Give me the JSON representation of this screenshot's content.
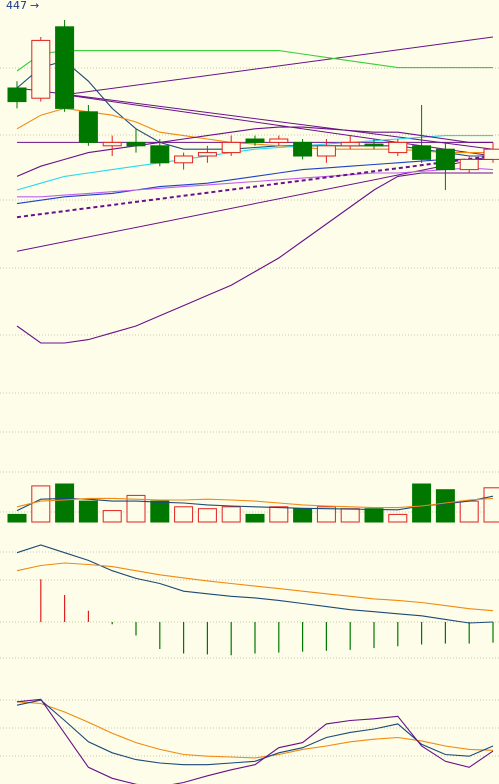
{
  "colors": {
    "background": "#fdfde9",
    "grid": "#9a9a78",
    "up": "#e02020",
    "down": "#007800",
    "ma_short": "#1c4a78",
    "ma_mid": "#f08a10",
    "ma_long": "#3ad03a",
    "cyan": "#28d8f0",
    "blue": "#2040c8",
    "purple": "#6a108a",
    "pink": "#c060f0"
  },
  "chart_data": [
    {
      "type": "candlestick",
      "title": "",
      "annotation": "447",
      "pointer_icon": "right-arrow-icon",
      "ylim": [
        0,
        100
      ],
      "grid": true,
      "candles": [
        {
          "open": 80,
          "close": 76,
          "high": 82,
          "low": 74
        },
        {
          "open": 77,
          "close": 94,
          "high": 95,
          "low": 76
        },
        {
          "open": 98,
          "close": 74,
          "high": 100,
          "low": 73
        },
        {
          "open": 73,
          "close": 64,
          "high": 75,
          "low": 63
        },
        {
          "open": 63,
          "close": 64,
          "high": 66,
          "low": 60
        },
        {
          "open": 64,
          "close": 63,
          "high": 68,
          "low": 61
        },
        {
          "open": 63,
          "close": 58,
          "high": 65,
          "low": 57
        },
        {
          "open": 58,
          "close": 60,
          "high": 61,
          "low": 56
        },
        {
          "open": 60,
          "close": 61,
          "high": 63,
          "low": 58
        },
        {
          "open": 61,
          "close": 64,
          "high": 66,
          "low": 60
        },
        {
          "open": 65,
          "close": 64,
          "high": 66,
          "low": 63
        },
        {
          "open": 64,
          "close": 65,
          "high": 66,
          "low": 63
        },
        {
          "open": 64,
          "close": 60,
          "high": 65,
          "low": 59
        },
        {
          "open": 60,
          "close": 63,
          "high": 65,
          "low": 58
        },
        {
          "open": 63,
          "close": 64,
          "high": 66,
          "low": 62
        },
        {
          "open": 63.5,
          "close": 63,
          "high": 65,
          "low": 62
        },
        {
          "open": 61,
          "close": 64,
          "high": 65,
          "low": 60
        },
        {
          "open": 63,
          "close": 59,
          "high": 75,
          "low": 58
        },
        {
          "open": 62,
          "close": 56,
          "high": 64,
          "low": 50
        },
        {
          "open": 56,
          "close": 59,
          "high": 60,
          "low": 55
        },
        {
          "open": 59,
          "close": 62,
          "high": 64,
          "low": 58
        }
      ],
      "lines": [
        {
          "color": "ma_short",
          "values": [
            80,
            86,
            88,
            82,
            74,
            68,
            64,
            62,
            62,
            62,
            62.5,
            63,
            63,
            63,
            63,
            63,
            63,
            62,
            61,
            60,
            60
          ]
        },
        {
          "color": "ma_mid",
          "values": [
            68,
            72,
            74,
            73,
            72,
            70,
            67,
            66,
            65,
            64,
            63.5,
            63,
            62.5,
            62,
            62,
            62,
            62,
            61.5,
            61,
            61,
            61
          ]
        },
        {
          "color": "ma_long",
          "values": [
            85,
            90,
            91,
            91,
            91,
            91,
            91,
            91,
            91,
            91,
            91,
            91,
            90,
            89,
            88,
            87,
            86,
            86,
            86,
            86,
            86
          ]
        },
        {
          "color": "cyan",
          "values": [
            50,
            52,
            54,
            55,
            56,
            57,
            58,
            59,
            60,
            61,
            62,
            62.5,
            63,
            63.5,
            64,
            64.5,
            65,
            65.5,
            66,
            66,
            66
          ]
        },
        {
          "color": "blue",
          "values": [
            46,
            47,
            48,
            48.5,
            49,
            50,
            51,
            51.5,
            52,
            53,
            54,
            55,
            56,
            56.5,
            57,
            57.5,
            58,
            58.5,
            59,
            59,
            59
          ]
        },
        {
          "color": "pink",
          "values": [
            48,
            48,
            48.5,
            49,
            49.5,
            50,
            50.5,
            51,
            51.5,
            52,
            52.5,
            53,
            53.5,
            54,
            54.5,
            55,
            55,
            55.5,
            56,
            56.5,
            56
          ]
        },
        {
          "color": "purple",
          "values": [
            54,
            57,
            59,
            61,
            62,
            63,
            64,
            65,
            66,
            67,
            68,
            68.5,
            68.5,
            68,
            67.5,
            67,
            67,
            66,
            65,
            64,
            64
          ]
        },
        {
          "color": "purple",
          "values": [
            10,
            5,
            5,
            6,
            8,
            10,
            13,
            16,
            19,
            22,
            26,
            30,
            35,
            40,
            45,
            50,
            54,
            55,
            55,
            55,
            55
          ]
        }
      ],
      "dashed_trend": {
        "from": [
          0,
          42
        ],
        "to": [
          20,
          60
        ]
      },
      "trend_lines": [
        {
          "from": [
            0,
            32
          ],
          "to": [
            20,
            60
          ]
        },
        {
          "from": [
            2,
            78
          ],
          "to": [
            20,
            95
          ]
        },
        {
          "from": [
            0,
            80
          ],
          "to": [
            20,
            62
          ]
        },
        {
          "from": [
            2,
            78
          ],
          "to": [
            20,
            60
          ]
        },
        {
          "from": [
            0,
            64
          ],
          "to": [
            20,
            64
          ]
        }
      ]
    },
    {
      "type": "bar",
      "title": "",
      "ylim": [
        0,
        100
      ],
      "values": [
        20,
        95,
        100,
        55,
        30,
        70,
        55,
        40,
        35,
        40,
        20,
        40,
        35,
        40,
        35,
        35,
        20,
        100,
        85,
        55,
        90
      ],
      "up": [
        false,
        true,
        false,
        false,
        true,
        true,
        false,
        true,
        true,
        true,
        false,
        true,
        false,
        true,
        true,
        false,
        true,
        false,
        false,
        true,
        true
      ],
      "lines": [
        {
          "color": "ma_short",
          "values": [
            30,
            60,
            62,
            60,
            55,
            55,
            52,
            50,
            45,
            42,
            40,
            38,
            36,
            35,
            34,
            33,
            32,
            42,
            48,
            55,
            68
          ]
        },
        {
          "color": "ma_mid",
          "values": [
            40,
            55,
            58,
            62,
            62,
            60,
            58,
            58,
            60,
            58,
            55,
            50,
            45,
            42,
            40,
            38,
            38,
            42,
            50,
            58,
            62
          ]
        }
      ]
    },
    {
      "type": "macd",
      "title": "",
      "ylim": [
        -100,
        100
      ],
      "zero": 0,
      "histogram": [
        0,
        95,
        60,
        25,
        -5,
        -30,
        -60,
        -70,
        -72,
        -74,
        -70,
        -68,
        -66,
        -64,
        -62,
        -58,
        -54,
        -50,
        -48,
        -48,
        -46
      ],
      "lines": [
        {
          "color": "ma_short",
          "values": [
            185,
            200,
            185,
            170,
            150,
            135,
            125,
            110,
            105,
            100,
            97,
            92,
            86,
            80,
            74,
            70,
            66,
            62,
            55,
            48,
            50
          ]
        },
        {
          "color": "ma_mid",
          "values": [
            150,
            160,
            165,
            162,
            158,
            150,
            142,
            136,
            130,
            125,
            120,
            115,
            110,
            105,
            100,
            95,
            92,
            88,
            82,
            76,
            72
          ]
        }
      ]
    },
    {
      "type": "line",
      "title": "",
      "ylim": [
        0,
        100
      ],
      "lines": [
        {
          "color": "ma_mid",
          "values": [
            92,
            90,
            80,
            68,
            55,
            44,
            36,
            30,
            28,
            27,
            26,
            30,
            36,
            40,
            45,
            48,
            50,
            46,
            40,
            36,
            35
          ]
        },
        {
          "color": "ma_short",
          "values": [
            88,
            94,
            70,
            45,
            32,
            24,
            20,
            18,
            18,
            20,
            22,
            32,
            38,
            50,
            56,
            60,
            66,
            42,
            30,
            28,
            40
          ]
        },
        {
          "color": "purple",
          "values": [
            92,
            95,
            55,
            15,
            2,
            -5,
            -8,
            -3,
            5,
            12,
            18,
            38,
            44,
            66,
            70,
            72,
            75,
            40,
            22,
            15,
            34
          ]
        }
      ]
    }
  ]
}
